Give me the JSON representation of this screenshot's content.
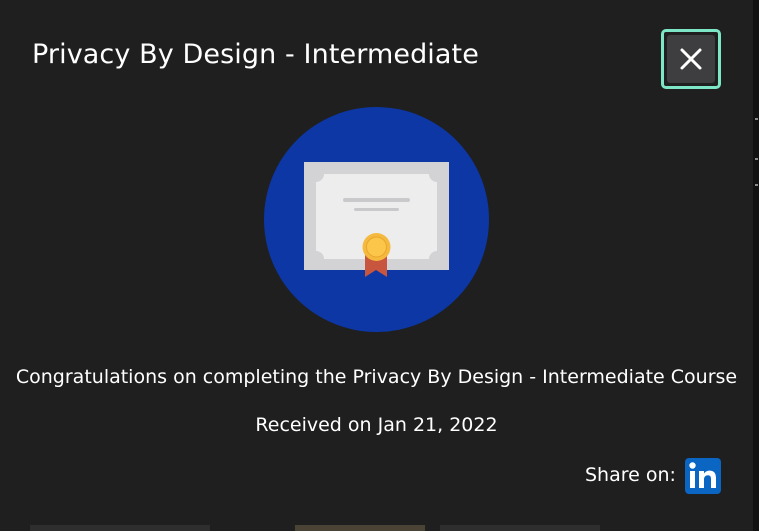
{
  "modal": {
    "title": "Privacy By Design - Intermediate",
    "close_icon": "close-icon",
    "badge_icon": "certificate-icon",
    "colors": {
      "background": "#1f1f20",
      "badge_circle": "#0c37a4",
      "focus_ring": "#7de6c7",
      "linkedin": "#0a66c2",
      "seal": "#f5b93d",
      "ribbon": "#c8553d"
    },
    "message": "Congratulations on completing the Privacy By Design - Intermediate Course",
    "received": "Received on Jan 21, 2022",
    "share_label": "Share on:",
    "share_icon": "linkedin-icon"
  }
}
